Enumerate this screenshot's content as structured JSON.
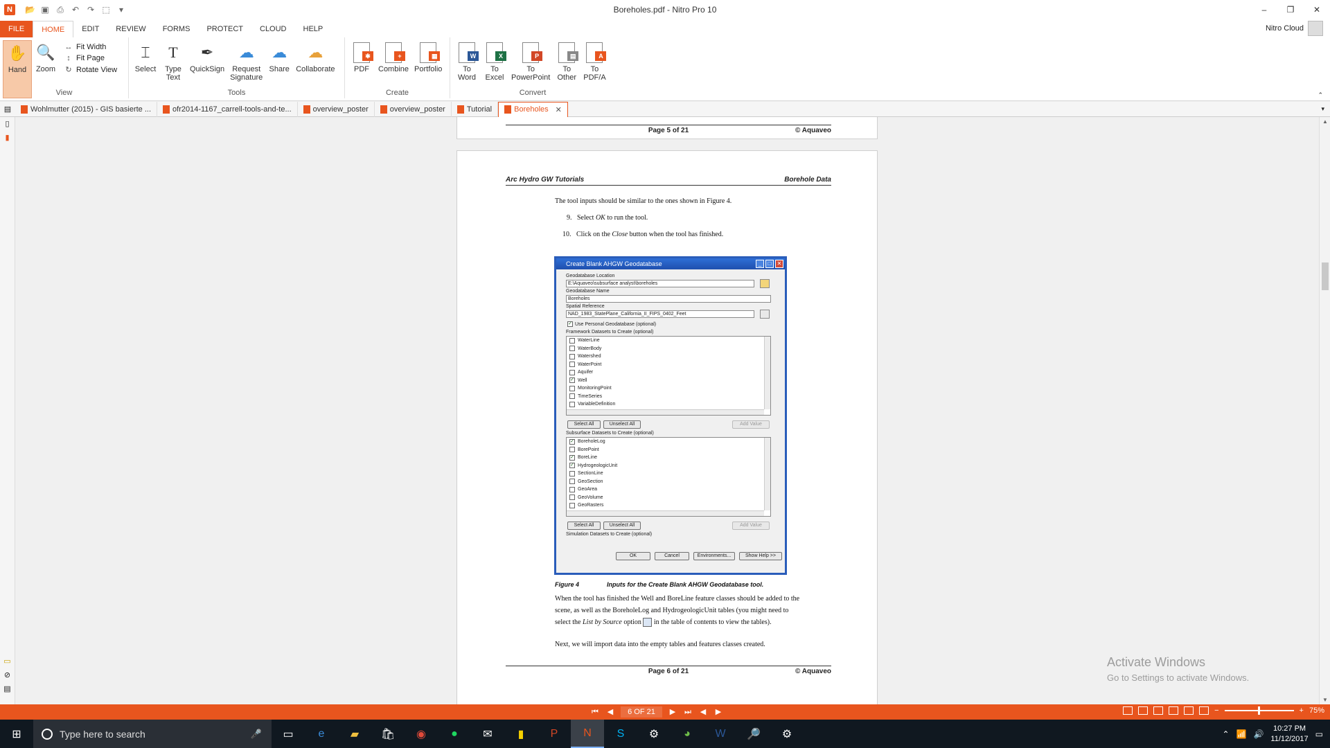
{
  "window": {
    "title": "Boreholes.pdf - Nitro Pro 10",
    "minimize": "–",
    "restore": "❐",
    "close": "✕"
  },
  "menu": {
    "tabs": [
      "FILE",
      "HOME",
      "EDIT",
      "REVIEW",
      "FORMS",
      "PROTECT",
      "CLOUD",
      "HELP"
    ],
    "active": "HOME",
    "account": "Nitro Cloud"
  },
  "ribbon": {
    "view": {
      "label": "View",
      "hand": "Hand",
      "zoom": "Zoom",
      "fit_width": "Fit Width",
      "fit_page": "Fit Page",
      "rotate_view": "Rotate View"
    },
    "tools": {
      "label": "Tools",
      "select": "Select",
      "type_text_1": "Type",
      "type_text_2": "Text",
      "quicksign": "QuickSign",
      "request_sig_1": "Request",
      "request_sig_2": "Signature",
      "share": "Share",
      "collaborate": "Collaborate"
    },
    "create": {
      "label": "Create",
      "pdf": "PDF",
      "combine": "Combine",
      "portfolio": "Portfolio"
    },
    "convert": {
      "label": "Convert",
      "to_word_1": "To",
      "to_word_2": "Word",
      "to_excel_1": "To",
      "to_excel_2": "Excel",
      "to_ppt_1": "To",
      "to_ppt_2": "PowerPoint",
      "to_other_1": "To",
      "to_other_2": "Other",
      "to_pdfa_1": "To",
      "to_pdfa_2": "PDF/A"
    }
  },
  "doc_tabs": [
    "Wohlmutter (2015) - GIS basierte ...",
    "ofr2014-1167_carrell-tools-and-te...",
    "overview_poster",
    "overview_poster",
    "Tutorial",
    "Boreholes"
  ],
  "page5": {
    "page_number": "Page 5 of 21",
    "copyright": "© Aquaveo"
  },
  "page6": {
    "header_left": "Arc Hydro GW Tutorials",
    "header_right": "Borehole Data",
    "intro": "The tool inputs should be similar to the ones shown in Figure 4.",
    "step9_num": "9.",
    "step9_a": "Select ",
    "step9_ok": "OK",
    "step9_b": " to run the tool.",
    "step10_num": "10.",
    "step10_a": "Click on the ",
    "step10_close": "Close",
    "step10_b": " button when the tool has finished.",
    "figure_label": "Figure 4",
    "figure_caption": "Inputs for the Create Blank AHGW Geodatabase tool.",
    "para1_line1": "When the tool has finished the Well and BoreLine feature classes should be added to the",
    "para1_line2": "scene, as well as the BoreholeLog and HydrogeologicUnit tables (you might need to",
    "para1_line3_a": "select the ",
    "para1_line3_em": "List by Source",
    "para1_line3_b": " option",
    "para1_line3_c": " in the table of contents to view the tables).",
    "para2": "Next, we will import data into the empty tables and features classes created.",
    "page_number": "Page 6 of 21",
    "copyright": "© Aquaveo"
  },
  "dialog": {
    "title": "Create Blank AHGW Geodatabase",
    "gdb_location_label": "Geodatabase Location",
    "gdb_location_value": "E:\\Aquaveo\\subsurface analyst\\boreholes",
    "gdb_name_label": "Geodatabase Name",
    "gdb_name_value": "Boreholes",
    "spatial_ref_label": "Spatial Reference",
    "spatial_ref_value": "NAD_1983_StatePlane_California_II_FIPS_0402_Feet",
    "use_personal": "Use Personal Geodatabase (optional)",
    "framework_label": "Framework Datasets to Create (optional)",
    "framework_items": [
      {
        "name": "WaterLine",
        "checked": false
      },
      {
        "name": "WaterBody",
        "checked": false
      },
      {
        "name": "Watershed",
        "checked": false
      },
      {
        "name": "WaterPoint",
        "checked": false
      },
      {
        "name": "Aquifer",
        "checked": false
      },
      {
        "name": "Well",
        "checked": true
      },
      {
        "name": "MonitoringPoint",
        "checked": false
      },
      {
        "name": "TimeSeries",
        "checked": false
      },
      {
        "name": "VariableDefinition",
        "checked": false
      }
    ],
    "select_all": "Select All",
    "unselect_all": "Unselect All",
    "add_value": "Add Value",
    "subsurface_label": "Subsurface Datasets to Create (optional)",
    "subsurface_items": [
      {
        "name": "BoreholeLog",
        "checked": true
      },
      {
        "name": "BorePoint",
        "checked": false
      },
      {
        "name": "BoreLine",
        "checked": true
      },
      {
        "name": "HydrogeologicUnit",
        "checked": true
      },
      {
        "name": "SectionLine",
        "checked": false
      },
      {
        "name": "GeoSection",
        "checked": false
      },
      {
        "name": "GeoArea",
        "checked": false
      },
      {
        "name": "GeoVolume",
        "checked": false
      },
      {
        "name": "GeoRasters",
        "checked": false
      }
    ],
    "simulation_label": "Simulation Datasets to Create (optional)",
    "ok": "OK",
    "cancel": "Cancel",
    "environments": "Environments...",
    "show_help": "Show Help >>"
  },
  "watermark": {
    "line1": "Activate Windows",
    "line2": "Go to Settings to activate Windows."
  },
  "status": {
    "page_indicator": "6 OF 21",
    "zoom": "75%"
  },
  "taskbar": {
    "search_placeholder": "Type here to search",
    "time": "10:27 PM",
    "date": "11/12/2017"
  },
  "colors": {
    "accent": "#e8551e",
    "taskbar": "#101820"
  }
}
